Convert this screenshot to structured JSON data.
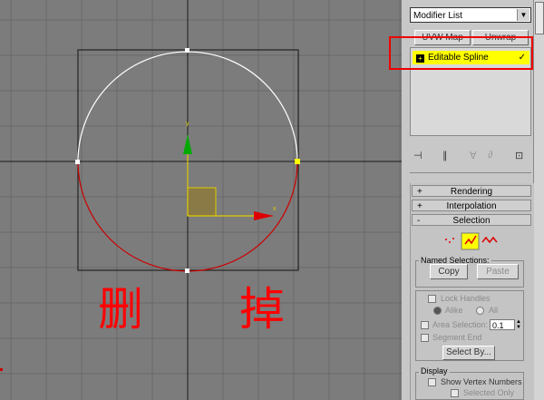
{
  "viewport": {
    "annotation": "删 掉",
    "colors": {
      "background": "#7c7c7c",
      "circle_top": "#ffffff",
      "circle_bottom": "#cc0000",
      "annotation": "#ff0000",
      "y_axis": "#00aa00",
      "x_axis": "#dd0000"
    },
    "gizmo": {
      "x_label": "x",
      "y_label": "y"
    }
  },
  "command_panel": {
    "modifier_list": "Modifier List",
    "buttons": {
      "uvw_map": "UVW Map",
      "unwrap_uvw": "Unwrap UVW"
    },
    "stack": {
      "selected_item": "Editable Spline",
      "highlight_color": "#ffff00"
    },
    "rollouts": [
      {
        "sign": "+",
        "label": "Rendering"
      },
      {
        "sign": "+",
        "label": "Interpolation"
      },
      {
        "sign": "-",
        "label": "Selection"
      }
    ],
    "selection": {
      "named_selections_label": "Named Selections:",
      "copy": "Copy",
      "paste": "Paste",
      "lock_handles": "Lock Handles",
      "alike": "Alike",
      "all": "All",
      "area_selection": "Area Selection:",
      "area_value": "0.1",
      "segment_end": "Segment End",
      "select_by": "Select By...",
      "display_label": "Display",
      "show_vertex_numbers": "Show Vertex Numbers",
      "selected_only": "Selected Only"
    },
    "redbox_color": "#ee0000"
  }
}
